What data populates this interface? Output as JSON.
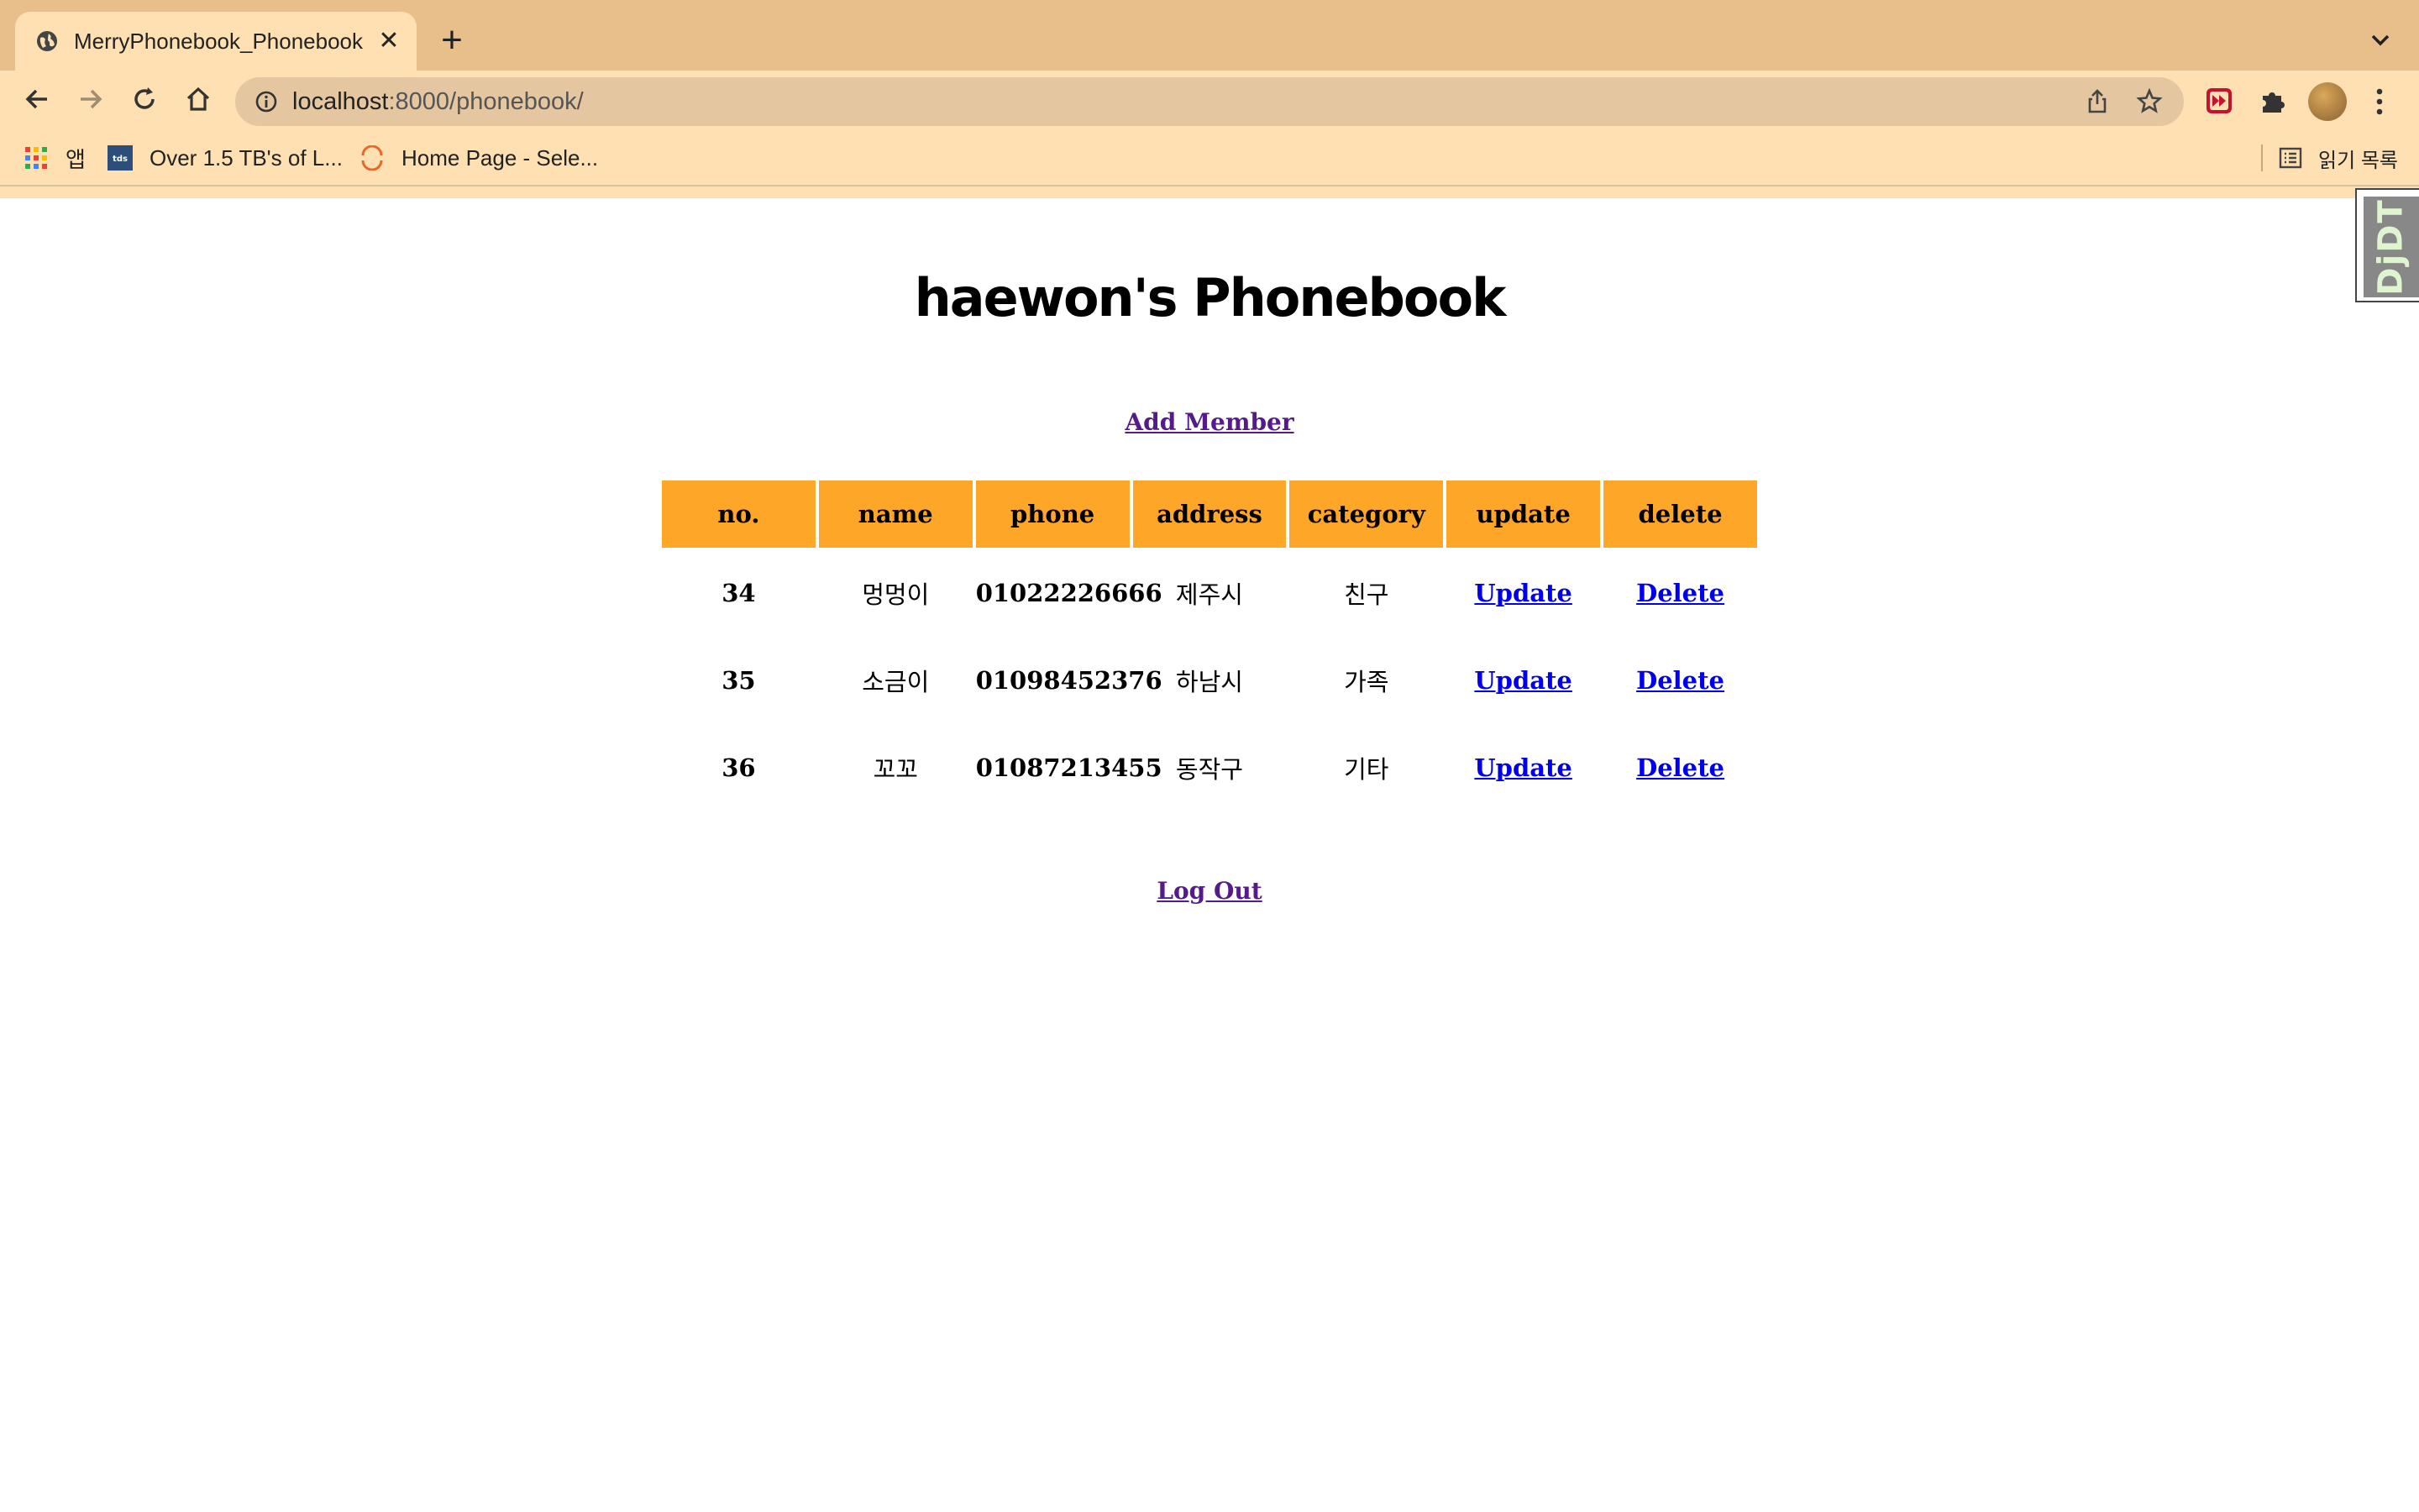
{
  "browser": {
    "tab_title": "MerryPhonebook_Phonebook",
    "url_host": "localhost",
    "url_path": ":8000/phonebook/",
    "bookmarks": [
      {
        "label": "앱",
        "icon": "apps-grid-icon"
      },
      {
        "label": "Over 1.5 TB's of L...",
        "icon": "tds-icon"
      },
      {
        "label": "Home Page - Sele...",
        "icon": "selenium-icon"
      }
    ],
    "reading_list_label": "읽기 목록"
  },
  "page": {
    "title": "haewon's Phonebook",
    "add_member_label": "Add Member",
    "logout_label": "Log Out",
    "debug_toolbar_label": "DjDT"
  },
  "table": {
    "headers": [
      "no.",
      "name",
      "phone",
      "address",
      "category",
      "update",
      "delete"
    ],
    "rows": [
      {
        "no": "34",
        "name": "멍멍이",
        "phone": "01022226666",
        "address": "제주시",
        "category": "친구",
        "update": "Update",
        "delete": "Delete"
      },
      {
        "no": "35",
        "name": "소금이",
        "phone": "01098452376",
        "address": "하남시",
        "category": "가족",
        "update": "Update",
        "delete": "Delete"
      },
      {
        "no": "36",
        "name": "꼬꼬",
        "phone": "01087213455",
        "address": "동작구",
        "category": "기타",
        "update": "Update",
        "delete": "Delete"
      }
    ]
  },
  "colors": {
    "tabstrip": "#e8be8a",
    "toolbar": "#fee0b2",
    "header_cell": "#fea628",
    "visited_link": "#551a8b",
    "link": "#0000ee"
  }
}
